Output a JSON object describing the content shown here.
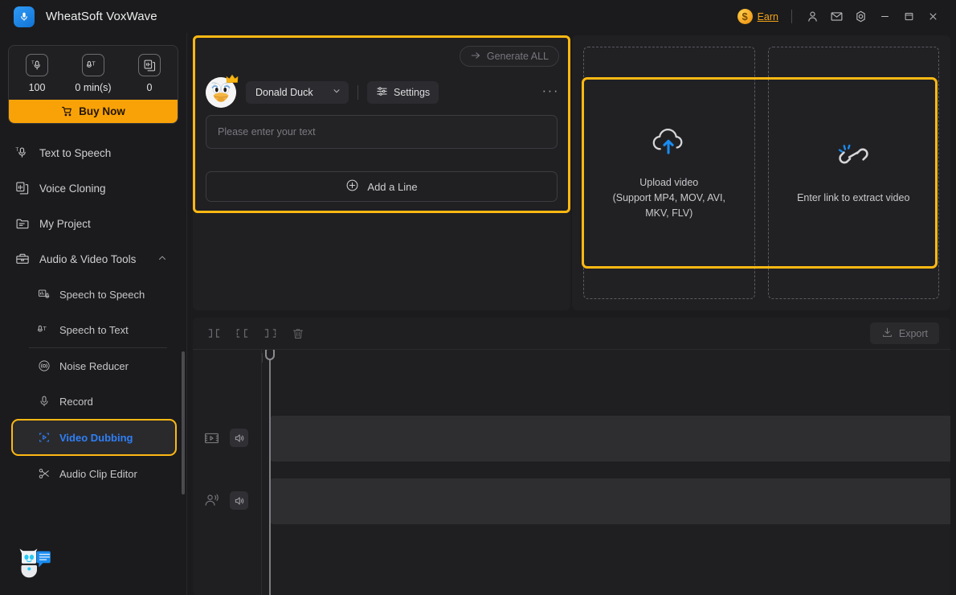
{
  "window": {
    "title": "WheatSoft VoxWave",
    "logo_icon": "microphone-logo-icon"
  },
  "titlebar": {
    "earn_label": "Earn",
    "coin_symbol": "$",
    "buttons": [
      {
        "name": "account-icon",
        "label": "Account"
      },
      {
        "name": "mail-icon",
        "label": "Messages"
      },
      {
        "name": "settings-gear-icon",
        "label": "Settings"
      },
      {
        "name": "minimize-icon",
        "label": "Minimize"
      },
      {
        "name": "maximize-icon",
        "label": "Maximize"
      },
      {
        "name": "close-icon",
        "label": "Close"
      }
    ]
  },
  "sidebar": {
    "credits": [
      {
        "icon": "text-to-speech-credit-icon",
        "value": "100"
      },
      {
        "icon": "speech-to-text-credit-icon",
        "value": "0 min(s)"
      },
      {
        "icon": "voice-clone-credit-icon",
        "value": "0"
      }
    ],
    "buy_now_label": "Buy Now",
    "nav": [
      {
        "label": "Text to Speech",
        "icon": "text-to-speech-icon",
        "active": false
      },
      {
        "label": "Voice Cloning",
        "icon": "voice-cloning-icon",
        "active": false
      },
      {
        "label": "My Project",
        "icon": "folder-icon",
        "active": false
      },
      {
        "label": "Audio & Video Tools",
        "icon": "toolbox-icon",
        "active": false,
        "expanded": true
      }
    ],
    "sub_nav": [
      {
        "label": "Speech to Speech",
        "icon": "speech-to-speech-icon",
        "active": false
      },
      {
        "label": "Speech to Text",
        "icon": "speech-to-text-icon",
        "active": false
      },
      {
        "label": "Noise Reducer",
        "icon": "noise-reducer-icon",
        "active": false
      },
      {
        "label": "Record",
        "icon": "microphone-icon",
        "active": false
      },
      {
        "label": "Video Dubbing",
        "icon": "video-dubbing-icon",
        "active": true
      },
      {
        "label": "Audio Clip Editor",
        "icon": "scissors-icon",
        "active": false
      }
    ],
    "assistant_icon": "chatbot-assistant-icon"
  },
  "editor": {
    "generate_all_label": "Generate ALL",
    "generate_all_icon": "arrow-right-icon",
    "voice_name": "Donald Duck",
    "avatar_icon": "donald-duck-avatar",
    "crown_icon": "crown-badge-icon",
    "settings_label": "Settings",
    "settings_icon": "sliders-icon",
    "more_label": "···",
    "text_placeholder": "Please enter your text",
    "add_line_label": "Add a Line",
    "add_line_icon": "plus-circle-icon"
  },
  "upload": {
    "video": {
      "icon": "cloud-upload-icon",
      "line1": "Upload video",
      "line2": "(Support MP4, MOV, AVI,",
      "line3": "MKV, FLV)"
    },
    "link": {
      "icon": "link-chain-icon",
      "label": "Enter link to extract video"
    }
  },
  "timeline": {
    "tools": [
      {
        "name": "trim-left-icon",
        "label": "Trim left"
      },
      {
        "name": "split-clip-icon",
        "label": "Split"
      },
      {
        "name": "trim-right-icon",
        "label": "Trim right"
      },
      {
        "name": "delete-trash-icon",
        "label": "Delete"
      }
    ],
    "export_label": "Export",
    "export_icon": "download-icon",
    "tracks": [
      {
        "name": "video-track",
        "icon": "film-strip-icon",
        "mute_icon": "speaker-icon"
      },
      {
        "name": "voice-track",
        "icon": "person-voice-icon",
        "mute_icon": "speaker-icon"
      }
    ]
  },
  "colors": {
    "accent_yellow": "#fdb813",
    "accent_blue": "#2f7ff5",
    "buy_orange": "#f9a208",
    "background": "#1b1b1d",
    "panel": "#202023"
  }
}
